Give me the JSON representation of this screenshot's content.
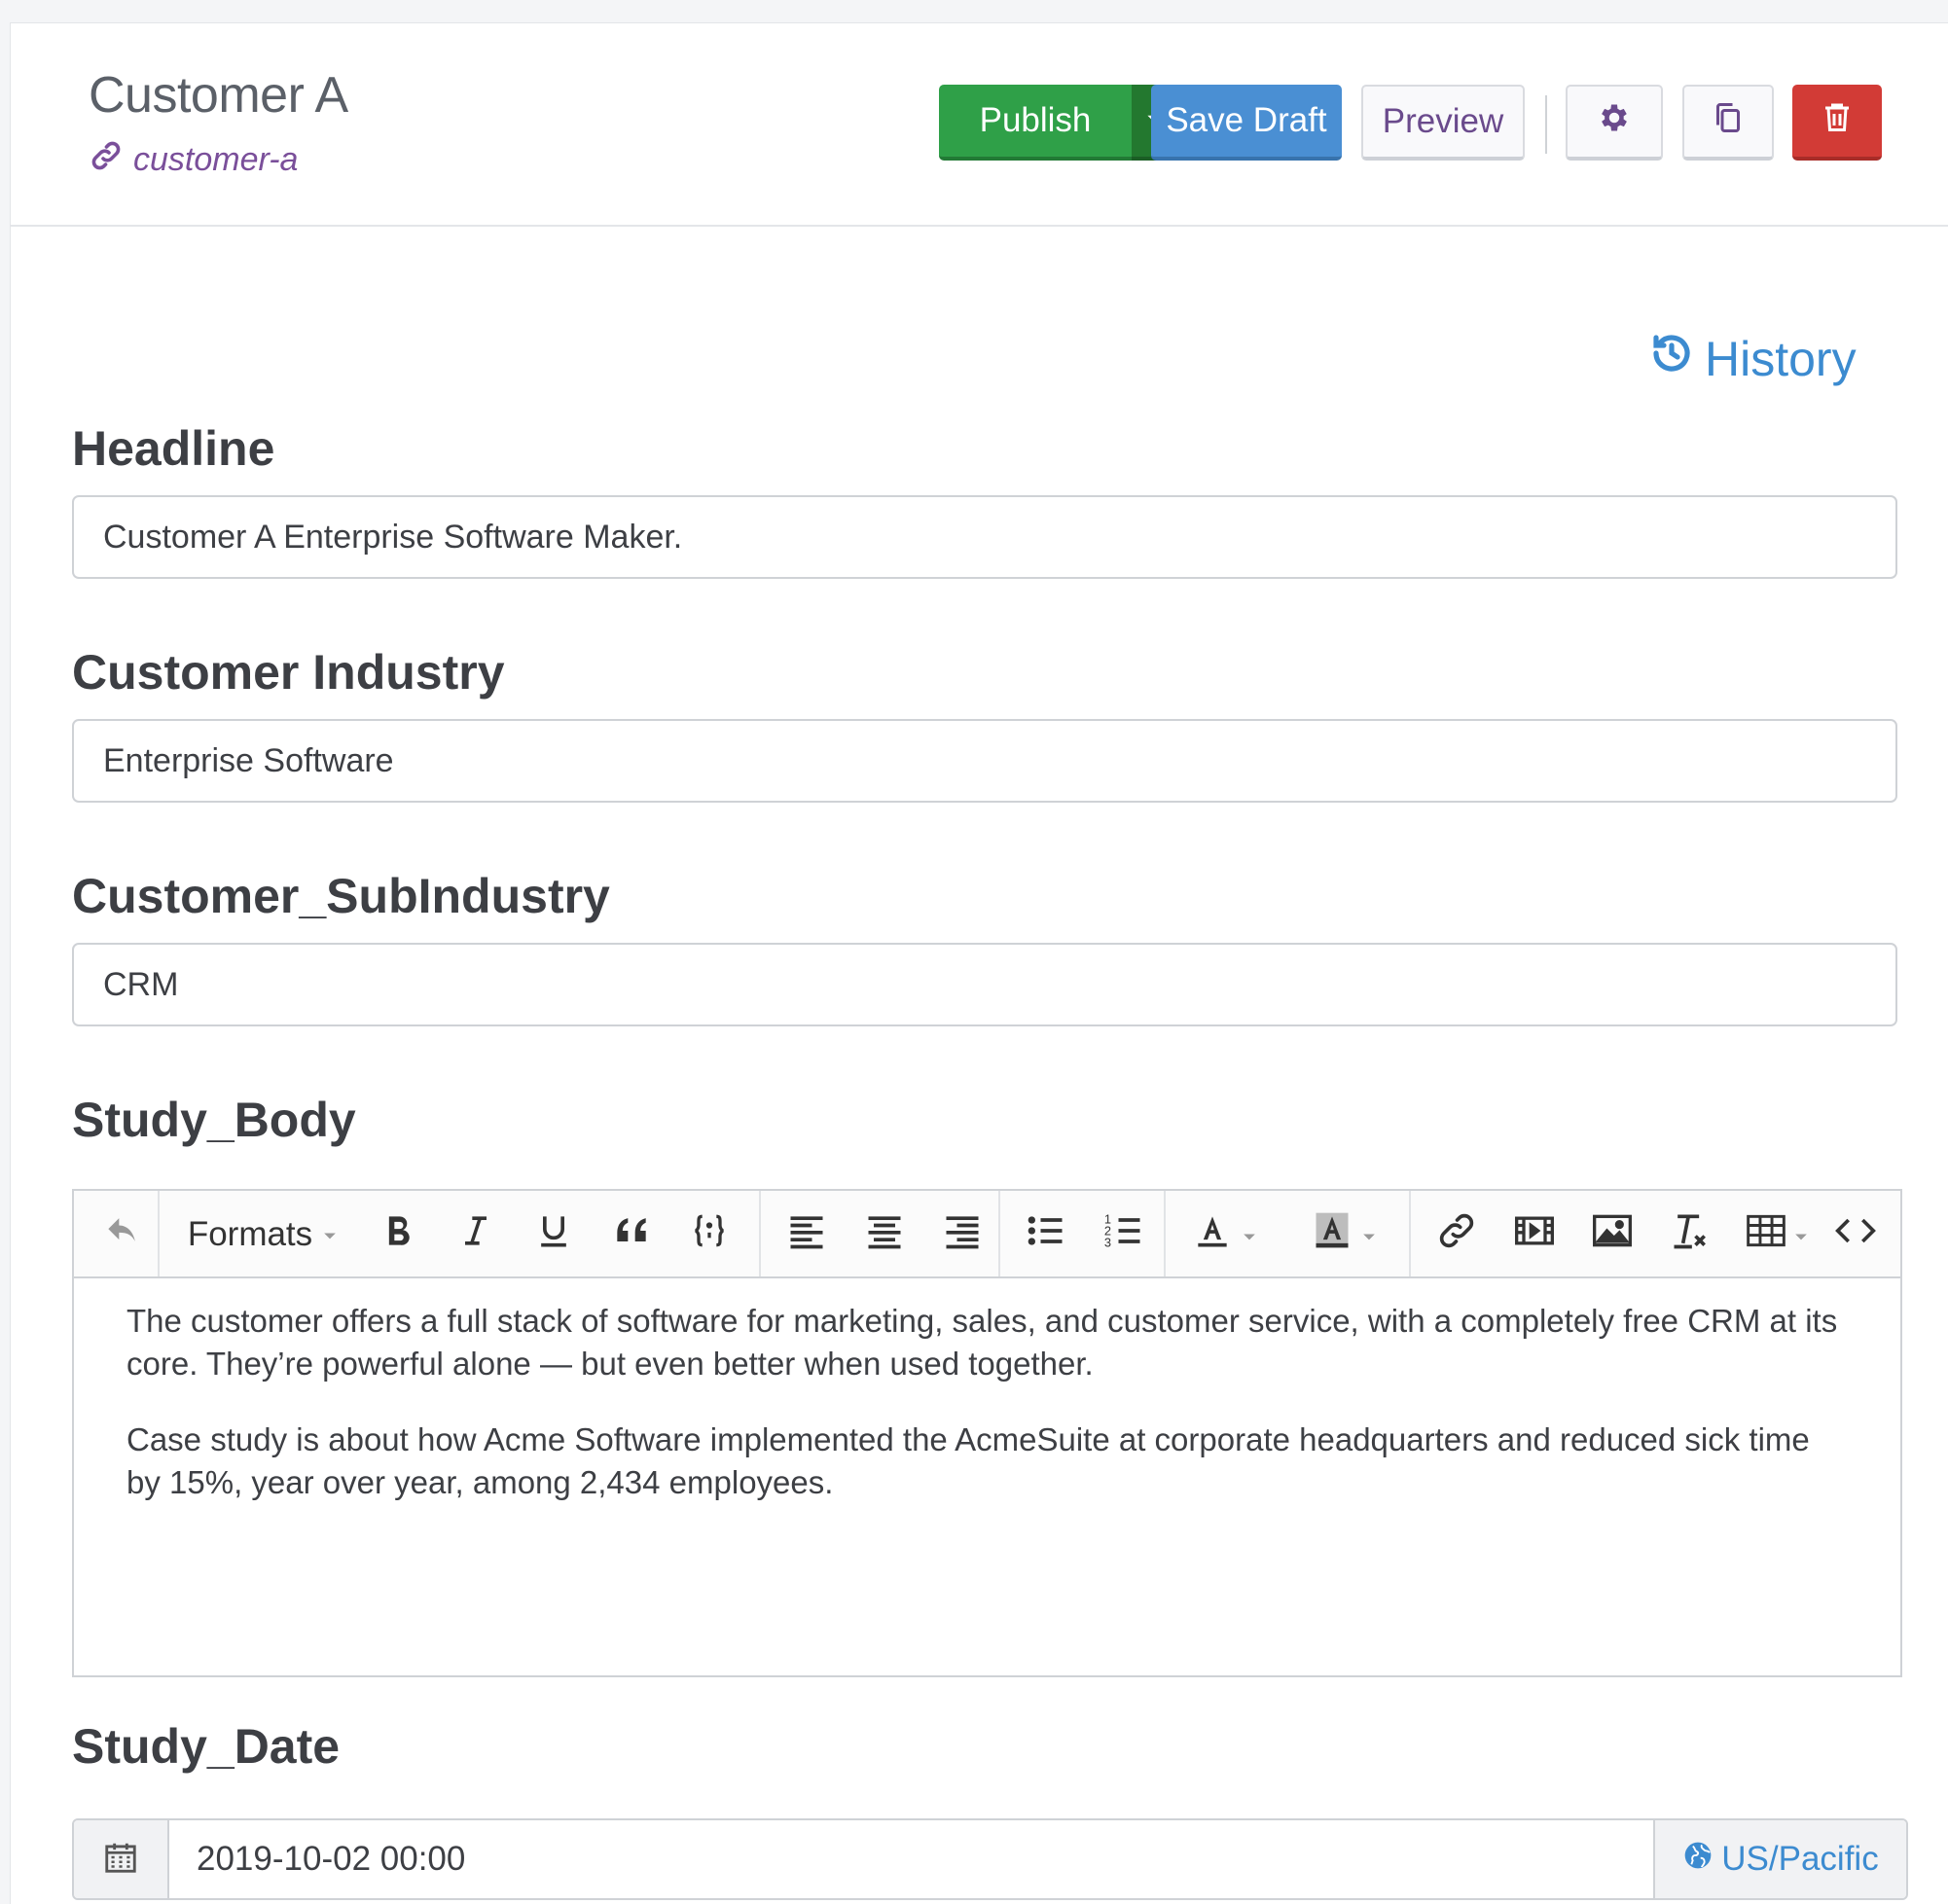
{
  "header": {
    "title": "Customer A",
    "slug": "customer-a",
    "buttons": {
      "publish": "Publish",
      "save_draft": "Save Draft",
      "preview": "Preview"
    }
  },
  "history_link": "History",
  "fields": {
    "headline": {
      "label": "Headline",
      "value": "Customer A Enterprise Software Maker."
    },
    "industry": {
      "label": "Customer Industry",
      "value": "Enterprise Software"
    },
    "subindustry": {
      "label": "Customer_SubIndustry",
      "value": "CRM"
    },
    "study_body": {
      "label": "Study_Body",
      "toolbar": {
        "formats_label": "Formats"
      },
      "paragraphs": [
        "The customer offers a full stack of software for marketing, sales, and customer service, with a completely free CRM at its core. They’re powerful alone — but even better when used together.",
        "Case study is about how Acme Software implemented the AcmeSuite at corporate headquarters and reduced sick time by 15%, year over year, among 2,434 employees."
      ]
    },
    "study_date": {
      "label": "Study_Date",
      "value": "2019-10-02 00:00",
      "timezone": "US/Pacific"
    }
  },
  "colors": {
    "publish": "#2fa048",
    "save_draft": "#4a8fd3",
    "delete": "#d23b36",
    "link_purple": "#7a4f9a",
    "history_blue": "#3c8bd0"
  }
}
